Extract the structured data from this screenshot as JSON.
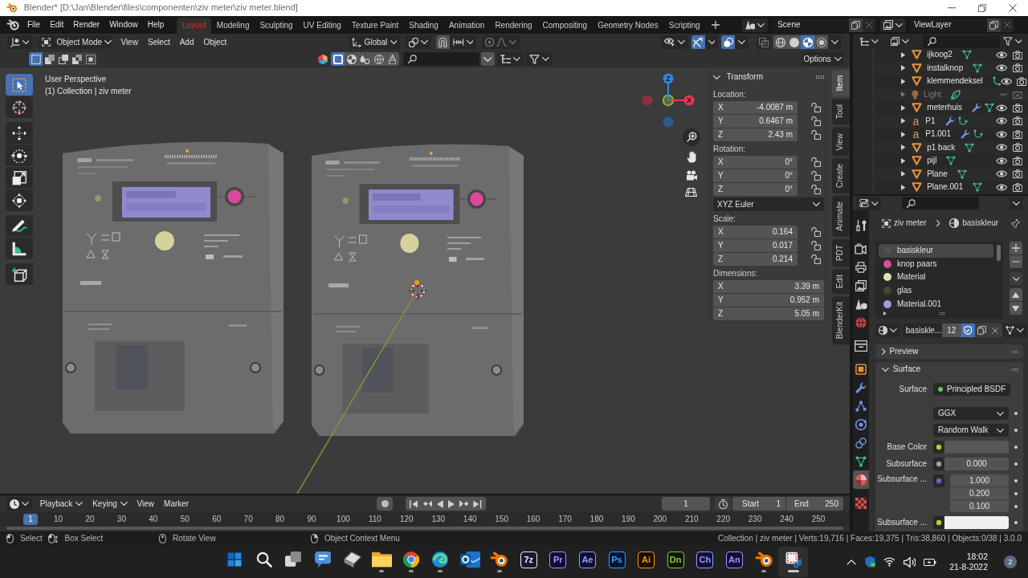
{
  "window": {
    "title": "Blender* [D:\\Jan\\Blender\\files\\componenten\\ziv meter\\ziv meter.blend]"
  },
  "top_bar": {
    "menus": [
      "File",
      "Edit",
      "Render",
      "Window",
      "Help"
    ],
    "workspaces": [
      {
        "label": "Layout",
        "selected": true
      },
      {
        "label": "Modeling",
        "selected": false
      },
      {
        "label": "Sculpting",
        "selected": false
      },
      {
        "label": "UV Editing",
        "selected": false
      },
      {
        "label": "Texture Paint",
        "selected": false
      },
      {
        "label": "Shading",
        "selected": false
      },
      {
        "label": "Animation",
        "selected": false
      },
      {
        "label": "Rendering",
        "selected": false
      },
      {
        "label": "Compositing",
        "selected": false
      },
      {
        "label": "Geometry Nodes",
        "selected": false
      },
      {
        "label": "Scripting",
        "selected": false
      }
    ],
    "scene": "Scene",
    "view_layer": "ViewLayer"
  },
  "viewport": {
    "mode": "Object Mode",
    "menus": [
      "View",
      "Select",
      "Add",
      "Object"
    ],
    "orientation": "Global",
    "toggles": [
      {
        "kind": "gizmos",
        "on": true
      },
      {
        "kind": "overlays",
        "on": true
      },
      {
        "kind": "xray",
        "on": false
      }
    ],
    "shading": [
      {
        "kind": "wireframe",
        "selected": false
      },
      {
        "kind": "solid",
        "selected": false
      },
      {
        "kind": "material",
        "selected": true
      },
      {
        "kind": "rendered",
        "selected": false
      }
    ],
    "select_modes": [
      {
        "kind": "set",
        "selected": true
      },
      {
        "kind": "extend",
        "selected": false
      },
      {
        "kind": "subtract",
        "selected": false
      },
      {
        "kind": "invert",
        "selected": false
      },
      {
        "kind": "intersect",
        "selected": false
      }
    ],
    "filters": [
      {
        "kind": "square",
        "selected": true
      },
      {
        "kind": "sphere",
        "selected": false
      },
      {
        "kind": "drops",
        "selected": false
      },
      {
        "kind": "globe",
        "selected": false
      },
      {
        "kind": "brush",
        "selected": false
      }
    ],
    "options": "Options",
    "info": [
      "User Perspective",
      "(1) Collection | ziv meter"
    ],
    "tool_groups": [
      [
        {
          "kind": "select-box",
          "selected": true
        },
        {
          "kind": "cursor",
          "selected": false
        }
      ],
      [
        {
          "kind": "move",
          "selected": false
        },
        {
          "kind": "rotate",
          "selected": false
        },
        {
          "kind": "scale",
          "selected": false
        },
        {
          "kind": "transform",
          "selected": false
        }
      ],
      [
        {
          "kind": "annotate",
          "selected": false
        },
        {
          "kind": "measure",
          "selected": false
        }
      ],
      [
        {
          "kind": "add-cube",
          "selected": false
        }
      ]
    ],
    "gizmo_axes": [
      {
        "kind": "negz"
      },
      {
        "kind": "negx"
      },
      {
        "kind": "y"
      },
      {
        "kind": "x",
        "label": "X"
      },
      {
        "kind": "z",
        "label": "Z"
      }
    ]
  },
  "sidebar": {
    "panel": "Transform",
    "groups": [
      {
        "label": "Location:",
        "rows": [
          {
            "axis": "X",
            "value": "-4.0087 m",
            "locked": false
          },
          {
            "axis": "Y",
            "value": "0.6467 m",
            "locked": false
          },
          {
            "axis": "Z",
            "value": "2.43 m",
            "locked": false
          }
        ]
      },
      {
        "label": "Rotation:",
        "rows": [
          {
            "axis": "X",
            "value": "0°",
            "locked": false
          },
          {
            "axis": "Y",
            "value": "0°",
            "locked": false
          },
          {
            "axis": "Z",
            "value": "0°",
            "locked": false
          }
        ],
        "mode": "XYZ Euler"
      },
      {
        "label": "Scale:",
        "rows": [
          {
            "axis": "X",
            "value": "0.164",
            "locked": false
          },
          {
            "axis": "Y",
            "value": "0.017",
            "locked": false
          },
          {
            "axis": "Z",
            "value": "0.214",
            "locked": false
          }
        ]
      },
      {
        "label": "Dimensions:",
        "rows": [
          {
            "axis": "X",
            "value": "3.39 m"
          },
          {
            "axis": "Y",
            "value": "0.952 m"
          },
          {
            "axis": "Z",
            "value": "5.05 m"
          }
        ]
      }
    ],
    "tabs": [
      {
        "label": "Item",
        "selected": true
      },
      {
        "label": "Tool",
        "selected": false
      },
      {
        "label": "View",
        "selected": false
      },
      {
        "label": "Create",
        "selected": false
      },
      {
        "label": "Animate",
        "selected": false
      },
      {
        "label": "PDT",
        "selected": false
      },
      {
        "label": "Edit",
        "selected": false
      },
      {
        "label": "BlenderKit",
        "selected": false
      }
    ]
  },
  "outliner": {
    "items": [
      {
        "name": "ijkoog2",
        "kind": "mesh",
        "data": [
          {
            "kind": "mesh"
          }
        ],
        "visible": true,
        "renderable": true
      },
      {
        "name": "instalknop",
        "kind": "mesh",
        "data": [
          {
            "kind": "mesh"
          }
        ],
        "visible": true,
        "renderable": true
      },
      {
        "name": "klemmendeksel",
        "kind": "mesh",
        "data": [
          {
            "kind": "path"
          }
        ],
        "visible": true,
        "renderable": true
      },
      {
        "name": "Light",
        "kind": "light",
        "data": [
          {
            "kind": "light"
          }
        ],
        "visible": false,
        "renderable": false
      },
      {
        "name": "meterhuis",
        "kind": "mesh",
        "data": [
          {
            "kind": "modifier"
          },
          {
            "kind": "mesh"
          }
        ],
        "visible": true,
        "renderable": true
      },
      {
        "name": "P1",
        "kind": "text",
        "glyph": "a",
        "data": [
          {
            "kind": "modifier"
          },
          {
            "kind": "curve"
          }
        ],
        "visible": true,
        "renderable": true
      },
      {
        "name": "P1.001",
        "kind": "text",
        "glyph": "a",
        "data": [
          {
            "kind": "modifier"
          },
          {
            "kind": "curve"
          }
        ],
        "visible": true,
        "renderable": true
      },
      {
        "name": "p1 back",
        "kind": "mesh",
        "data": [
          {
            "kind": "mesh"
          }
        ],
        "visible": true,
        "renderable": true
      },
      {
        "name": "pijl",
        "kind": "mesh",
        "data": [
          {
            "kind": "mesh"
          }
        ],
        "visible": true,
        "renderable": true
      },
      {
        "name": "Plane",
        "kind": "mesh",
        "data": [
          {
            "kind": "mesh"
          }
        ],
        "visible": true,
        "renderable": true
      },
      {
        "name": "Plane.001",
        "kind": "mesh",
        "data": [
          {
            "kind": "mesh"
          }
        ],
        "visible": true,
        "renderable": true
      }
    ]
  },
  "properties": {
    "tab_groups": [
      [
        {
          "kind": "tool",
          "selected": false
        }
      ],
      [
        {
          "kind": "render",
          "selected": false
        },
        {
          "kind": "output",
          "selected": false
        },
        {
          "kind": "view_layer",
          "selected": false
        },
        {
          "kind": "scene",
          "selected": false
        },
        {
          "kind": "world",
          "selected": false
        }
      ],
      [
        {
          "kind": "collection",
          "selected": false
        }
      ],
      [
        {
          "kind": "object",
          "selected": false
        },
        {
          "kind": "modifiers",
          "selected": false
        },
        {
          "kind": "particles",
          "selected": false
        },
        {
          "kind": "physics",
          "selected": false
        },
        {
          "kind": "constraints",
          "selected": false
        },
        {
          "kind": "data",
          "selected": false
        },
        {
          "kind": "material",
          "selected": true
        }
      ],
      [
        {
          "kind": "texture",
          "selected": false
        }
      ]
    ],
    "breadcrumb": [
      {
        "kind": "object",
        "label": "ziv meter"
      },
      {
        "kind": "material",
        "label": "basiskleur"
      }
    ],
    "slots": [
      {
        "name": "basiskleur",
        "color": "#505050",
        "selected": true
      },
      {
        "name": "knop paars",
        "color": "#d94c9e",
        "selected": false
      },
      {
        "name": "Material",
        "color": "#e2dfb4",
        "selected": false
      },
      {
        "name": "glas",
        "color": "#45443a",
        "selected": false
      },
      {
        "name": "Material.001",
        "color": "#a898dc",
        "selected": false
      }
    ],
    "material": {
      "name": "basiskle...",
      "users": "12",
      "fake_user": true
    },
    "panels": [
      {
        "title": "Preview",
        "expanded": false
      },
      {
        "title": "Surface",
        "expanded": true,
        "rows": [
          {
            "kind": "shader",
            "label": "Surface",
            "value": "Principled BSDF",
            "color": "#63c763"
          },
          {
            "kind": "dropdown",
            "value": "GGX"
          },
          {
            "kind": "dropdown",
            "value": "Random Walk"
          },
          {
            "kind": "color",
            "label": "Base Color",
            "color": "#c7c729",
            "swatch": {
              "color": "#575757"
            }
          },
          {
            "kind": "number",
            "label": "Subsurface",
            "value": "0.000",
            "color": "#a1a1a1"
          },
          {
            "kind": "vector",
            "label": "Subsurface ...",
            "values": [
              "1.000",
              "0.200",
              "0.100"
            ],
            "color": "#6363c7"
          },
          {
            "kind": "color",
            "label": "Subsurface ...",
            "color": "#c7c729",
            "swatch": {
              "color": "#f0f0f0"
            }
          }
        ]
      }
    ]
  },
  "timeline": {
    "menus": [
      {
        "label": "Playback",
        "dropdown": true
      },
      {
        "label": "Keying",
        "dropdown": true
      },
      {
        "label": "View",
        "dropdown": false
      },
      {
        "label": "Marker",
        "dropdown": false
      }
    ],
    "auto_keying": false,
    "frame": "1",
    "start": {
      "label": "Start",
      "value": "1"
    },
    "end": {
      "label": "End",
      "value": "250"
    },
    "ruler": [
      {
        "label": "1",
        "selected": true
      },
      {
        "label": "10",
        "selected": false
      },
      {
        "label": "20",
        "selected": false
      },
      {
        "label": "30",
        "selected": false
      },
      {
        "label": "40",
        "selected": false
      },
      {
        "label": "50",
        "selected": false
      },
      {
        "label": "60",
        "selected": false
      },
      {
        "label": "70",
        "selected": false
      },
      {
        "label": "80",
        "selected": false
      },
      {
        "label": "90",
        "selected": false
      },
      {
        "label": "100",
        "selected": false
      },
      {
        "label": "110",
        "selected": false
      },
      {
        "label": "120",
        "selected": false
      },
      {
        "label": "130",
        "selected": false
      },
      {
        "label": "140",
        "selected": false
      },
      {
        "label": "150",
        "selected": false
      },
      {
        "label": "160",
        "selected": false
      },
      {
        "label": "170",
        "selected": false
      },
      {
        "label": "180",
        "selected": false
      },
      {
        "label": "190",
        "selected": false
      },
      {
        "label": "200",
        "selected": false
      },
      {
        "label": "210",
        "selected": false
      },
      {
        "label": "220",
        "selected": false
      },
      {
        "label": "230",
        "selected": false
      },
      {
        "label": "240",
        "selected": false
      },
      {
        "label": "250",
        "selected": false
      }
    ]
  },
  "status_bar": {
    "hints": [
      {
        "kind": "mouse-left",
        "label": "Select"
      },
      {
        "kind": "mouse-drag",
        "label": "Box Select"
      },
      {
        "kind": "mouse-middle",
        "label": "Rotate View"
      },
      {
        "kind": "mouse-right",
        "label": "Object Context Menu"
      }
    ],
    "stats": "Collection | ziv meter | Verts:19,716 | Faces:19,375 | Tris:38,860 | Objects:0/38 | 3.0.0"
  },
  "taskbar": {
    "apps": [
      {
        "kind": "start",
        "running": false,
        "selected": false
      },
      {
        "kind": "search",
        "running": false,
        "selected": false
      },
      {
        "kind": "task-view",
        "running": false,
        "selected": false
      },
      {
        "kind": "translator",
        "running": false,
        "selected": false
      },
      {
        "kind": "scanner",
        "running": false,
        "selected": false
      },
      {
        "kind": "folder",
        "running": true,
        "selected": false
      },
      {
        "kind": "chrome",
        "running": true,
        "selected": false
      },
      {
        "kind": "edge",
        "running": true,
        "selected": false
      },
      {
        "kind": "outlook",
        "running": false,
        "selected": false
      },
      {
        "kind": "blender",
        "running": true,
        "selected": false
      },
      {
        "kind": "tile",
        "label": "7z",
        "color": "#f0f0f0",
        "running": false,
        "selected": false
      },
      {
        "kind": "tile",
        "label": "Pr",
        "color": "#9999ff",
        "running": false,
        "selected": false
      },
      {
        "kind": "tile",
        "label": "Ae",
        "color": "#9999ff",
        "running": false,
        "selected": false
      },
      {
        "kind": "tile",
        "label": "Ps",
        "color": "#31a8ff",
        "running": false,
        "selected": false
      },
      {
        "kind": "tile",
        "label": "Ai",
        "color": "#ff9a00",
        "running": false,
        "selected": false
      },
      {
        "kind": "tile",
        "label": "Dn",
        "color": "#7ed321",
        "running": false,
        "selected": false
      },
      {
        "kind": "tile",
        "label": "Ch",
        "color": "#9999ff",
        "running": false,
        "selected": false
      },
      {
        "kind": "tile",
        "label": "An",
        "color": "#9999ff",
        "running": false,
        "selected": false
      },
      {
        "kind": "blender",
        "running": true,
        "selected": false
      },
      {
        "kind": "snipping",
        "running": true,
        "selected": true
      }
    ],
    "tray": {
      "time": "18:02",
      "date": "21-8-2022",
      "notifications": "2"
    }
  }
}
